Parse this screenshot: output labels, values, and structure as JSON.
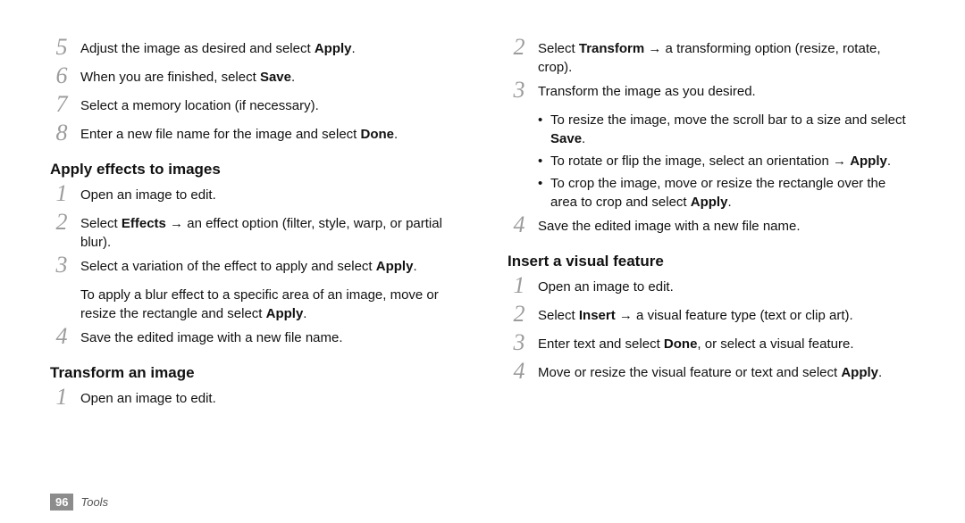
{
  "footer": {
    "page": "96",
    "section": "Tools"
  },
  "left": {
    "step5": {
      "n": "5",
      "pre": "Adjust the image as desired and select ",
      "bold": "Apply",
      "post": "."
    },
    "step6": {
      "n": "6",
      "pre": "When you are finished, select ",
      "bold": "Save",
      "post": "."
    },
    "step7": {
      "n": "7",
      "txt": "Select a memory location (if necessary)."
    },
    "step8": {
      "n": "8",
      "pre": "Enter a new file name for the image and select ",
      "bold": "Done",
      "post": "."
    },
    "sectA": "Apply effects to images",
    "a1": {
      "n": "1",
      "txt": "Open an image to edit."
    },
    "a2": {
      "n": "2",
      "pre": "Select ",
      "bold": "Effects",
      "post": " → an effect option (filter, style, warp, or partial blur)."
    },
    "a3": {
      "n": "3",
      "pre": "Select a variation of the effect to apply and select ",
      "bold": "Apply",
      "post": "."
    },
    "a3sub": {
      "pre": "To apply a blur effect to a specific area of an image, move or resize the rectangle and select ",
      "bold": "Apply",
      "post": "."
    },
    "a4": {
      "n": "4",
      "txt": "Save the edited image with a new file name."
    },
    "sectB": "Transform an image",
    "b1": {
      "n": "1",
      "txt": "Open an image to edit."
    }
  },
  "right": {
    "b2": {
      "n": "2",
      "pre": "Select ",
      "bold": "Transform",
      "post": " → a transforming option (resize, rotate, crop)."
    },
    "b3": {
      "n": "3",
      "txt": "Transform the image as you desired."
    },
    "b3_1": {
      "pre": "To resize the image, move the scroll bar to a size and select ",
      "bold": "Save",
      "post": "."
    },
    "b3_2": {
      "pre": "To rotate or flip the image, select an orientation → ",
      "bold": "Apply",
      "post": "."
    },
    "b3_3": {
      "pre": "To crop the image, move or resize the rectangle over the area to crop and select ",
      "bold": "Apply",
      "post": "."
    },
    "b4": {
      "n": "4",
      "txt": "Save the edited image with a new file name."
    },
    "sectC": "Insert a visual feature",
    "c1": {
      "n": "1",
      "txt": "Open an image to edit."
    },
    "c2": {
      "n": "2",
      "pre": "Select ",
      "bold": "Insert",
      "post": " → a visual feature type (text or clip art)."
    },
    "c3": {
      "n": "3",
      "pre": "Enter text and select ",
      "bold": "Done",
      "post": ", or select a visual feature."
    },
    "c4": {
      "n": "4",
      "pre": "Move or resize the visual feature or text and select ",
      "bold": "Apply",
      "post": "."
    }
  },
  "bullet": "•"
}
